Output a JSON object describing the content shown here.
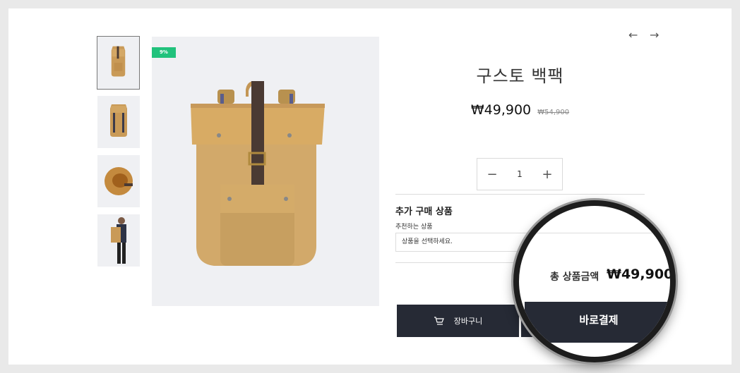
{
  "product": {
    "discount_badge": "9%",
    "title": "구스토 백팩",
    "price": "₩49,900",
    "original_price": "₩54,900"
  },
  "gallery": {
    "thumbnails": [
      "backpack-front",
      "backpack-back",
      "backpack-top",
      "backpack-model"
    ],
    "selected_index": 0,
    "prev_arrow": "←",
    "next_arrow": "→"
  },
  "quantity": {
    "minus": "−",
    "value": "1",
    "plus": "+"
  },
  "addon": {
    "title": "추가 구매 상품",
    "recommended_label": "추천하는 상품",
    "select_placeholder": "상품을 선택하세요."
  },
  "total": {
    "label": "총 상품금액",
    "amount": "₩49,900"
  },
  "actions": {
    "cart_label": "장바구니",
    "buy_label": "바로결제"
  },
  "colors": {
    "button_bg": "#262a35",
    "badge_green": "#21c27c",
    "image_bg": "#eff0f3"
  }
}
